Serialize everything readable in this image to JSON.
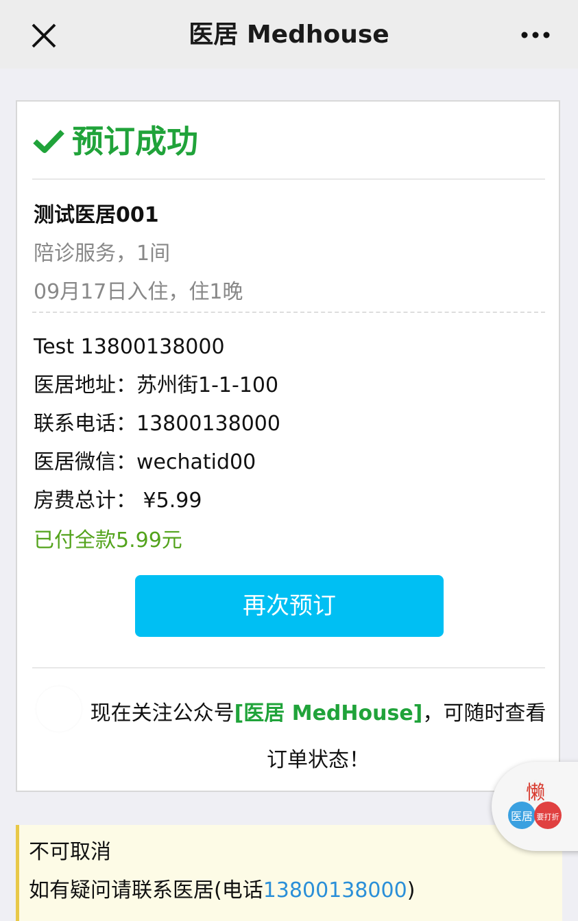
{
  "topbar": {
    "close_icon": "close-icon",
    "title": "医居 Medhouse",
    "more_icon": "more-dots-icon"
  },
  "status": {
    "icon": "check-icon",
    "text": "预订成功",
    "color": "#20a33a"
  },
  "booking": {
    "hotel_name": "测试医居001",
    "service": "陪诊服务，1间",
    "stay": "09月17日入住，住1晚"
  },
  "details": {
    "guest": "Test   13800138000",
    "address": "医居地址：苏州街1-1-100",
    "phone": "联系电话：13800138000",
    "wechat": "医居微信：wechatid00",
    "total": "房费总计： ¥5.99",
    "paid": "已付全款5.99元"
  },
  "rebook_button": {
    "label": "再次预订",
    "color": "#00bff3"
  },
  "follow": {
    "prefix": "现在关注公众号",
    "brand": "[医居 MedHouse]",
    "suffix": "，可随时查看订单状态！"
  },
  "notice": {
    "line1": "不可取消",
    "line2_prefix": "如有疑问请联系医居(电话",
    "phone": "13800138000",
    "line2_suffix": ")"
  },
  "float_badge": {
    "top_char": "懒",
    "left_label": "医居",
    "right_label": "要打折"
  }
}
